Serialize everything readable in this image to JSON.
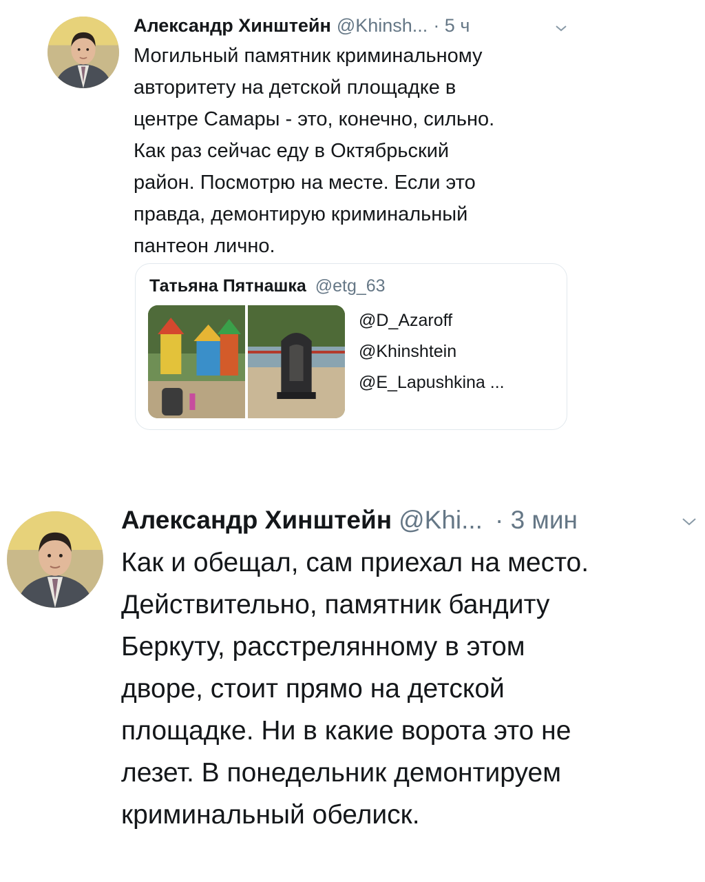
{
  "tweets": [
    {
      "author_name": "Александр Хинштейн",
      "handle": "@Khinsh...",
      "time": "· 5 ч",
      "lines": [
        "Могильный памятник криминальному",
        "авторитету на детской площадке в",
        "центре Самары - это, конечно, сильно.",
        "Как раз сейчас еду в Октябрьский",
        "район. Посмотрю на месте. Если это",
        "правда, демонтирую криминальный",
        "пантеон лично."
      ],
      "quote": {
        "author_name": "Татьяна Пятнашка",
        "handle": "@etg_63",
        "mentions": [
          "@D_Azaroff",
          "@Khinshtein",
          "@E_Lapushkina  ..."
        ]
      }
    },
    {
      "author_name": "Александр Хинштейн",
      "handle": "@Khi...",
      "time": "· 3 мин",
      "lines": [
        "Как и обещал, сам приехал на место.",
        "Действительно, памятник бандиту",
        "Беркуту, расстрелянному в этом",
        "дворе, стоит прямо на детской",
        "площадке. Ни в какие ворота это не",
        "лезет. В понедельник демонтируем",
        "криминальный обелиск."
      ]
    }
  ],
  "icons": {
    "avatar": "user-avatar-photo",
    "chevron": "chevron-down-icon",
    "media": [
      "playground-photo",
      "gravestone-photo"
    ]
  },
  "colors": {
    "text": "#14171a",
    "secondary": "#657786",
    "border": "#e1e8ed"
  }
}
